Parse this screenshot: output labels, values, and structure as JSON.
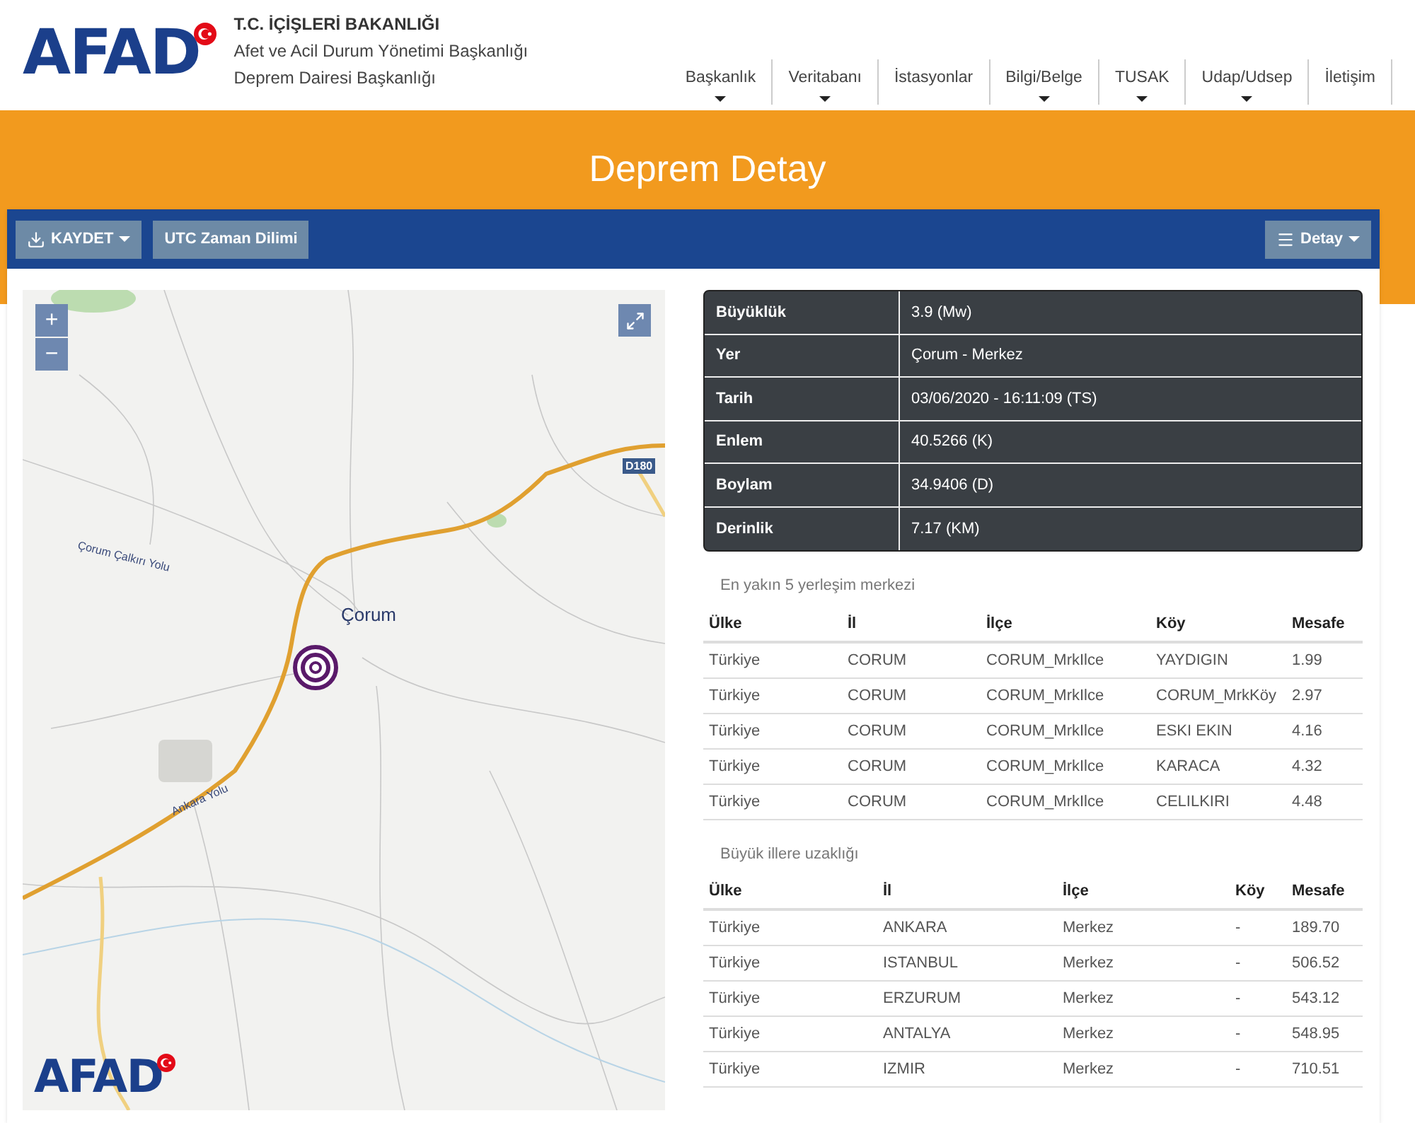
{
  "header": {
    "logo": "AFAD",
    "ministry": "T.C. İÇİŞLERİ BAKANLIĞI",
    "agency": "Afet ve Acil Durum Yönetimi Başkanlığı",
    "department": "Deprem Dairesi Başkanlığı"
  },
  "nav": [
    {
      "label": "Başkanlık",
      "has_menu": true
    },
    {
      "label": "Veritabanı",
      "has_menu": true
    },
    {
      "label": "İstasyonlar",
      "has_menu": false
    },
    {
      "label": "Bilgi/Belge",
      "has_menu": true
    },
    {
      "label": "TUSAK",
      "has_menu": true
    },
    {
      "label": "Udap/Udsep",
      "has_menu": true
    },
    {
      "label": "İletişim",
      "has_menu": false
    }
  ],
  "page_title": "Deprem Detay",
  "toolbar": {
    "save": "KAYDET",
    "timezone": "UTC Zaman Dilimi",
    "detail": "Detay"
  },
  "map": {
    "zoom_in": "+",
    "zoom_out": "−",
    "city_label": "Çorum",
    "road_badge": "D180",
    "road_label_1": "Çorum Çalkırı Yolu",
    "road_label_2": "Ankara Yolu",
    "logo": "AFAD"
  },
  "details": [
    {
      "label": "Büyüklük",
      "value": "3.9 (Mw)"
    },
    {
      "label": "Yer",
      "value": "Çorum - Merkez"
    },
    {
      "label": "Tarih",
      "value": "03/06/2020 - 16:11:09 (TS)"
    },
    {
      "label": "Enlem",
      "value": "40.5266 (K)"
    },
    {
      "label": "Boylam",
      "value": "34.9406 (D)"
    },
    {
      "label": "Derinlik",
      "value": "7.17 (KM)"
    }
  ],
  "nearest": {
    "title": "En yakın 5 yerleşim merkezi",
    "columns": [
      "Ülke",
      "İl",
      "İlçe",
      "Köy",
      "Mesafe"
    ],
    "rows": [
      [
        "Türkiye",
        "CORUM",
        "CORUM_MrkIlce",
        "YAYDIGIN",
        "1.99"
      ],
      [
        "Türkiye",
        "CORUM",
        "CORUM_MrkIlce",
        "CORUM_MrkKöy",
        "2.97"
      ],
      [
        "Türkiye",
        "CORUM",
        "CORUM_MrkIlce",
        "ESKI EKIN",
        "4.16"
      ],
      [
        "Türkiye",
        "CORUM",
        "CORUM_MrkIlce",
        "KARACA",
        "4.32"
      ],
      [
        "Türkiye",
        "CORUM",
        "CORUM_MrkIlce",
        "CELILKIRI",
        "4.48"
      ]
    ]
  },
  "cities": {
    "title": "Büyük illere uzaklığı",
    "columns": [
      "Ülke",
      "İl",
      "İlçe",
      "Köy",
      "Mesafe"
    ],
    "rows": [
      [
        "Türkiye",
        "ANKARA",
        "Merkez",
        "-",
        "189.70"
      ],
      [
        "Türkiye",
        "ISTANBUL",
        "Merkez",
        "-",
        "506.52"
      ],
      [
        "Türkiye",
        "ERZURUM",
        "Merkez",
        "-",
        "543.12"
      ],
      [
        "Türkiye",
        "ANTALYA",
        "Merkez",
        "-",
        "548.95"
      ],
      [
        "Türkiye",
        "IZMIR",
        "Merkez",
        "-",
        "710.51"
      ]
    ]
  }
}
